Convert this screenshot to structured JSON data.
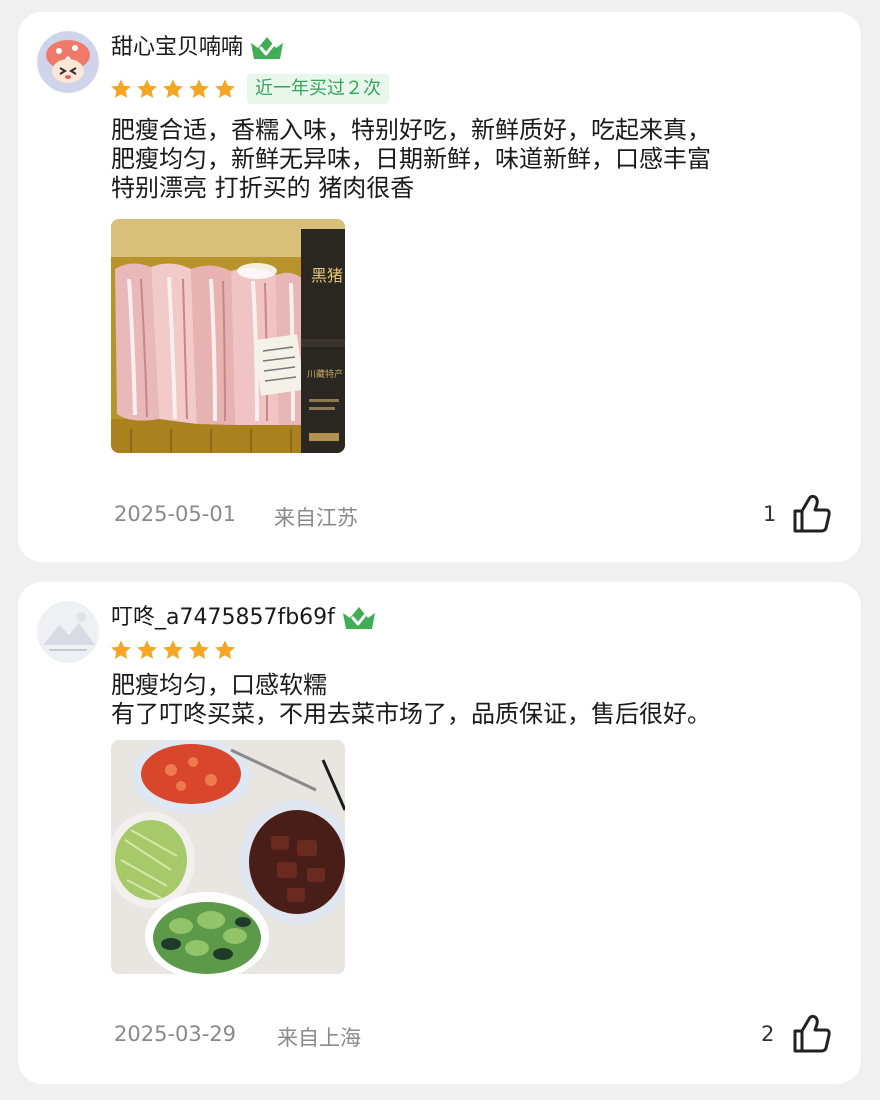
{
  "reviews": [
    {
      "username": "甜心宝贝喃喃",
      "stars": 5,
      "tag": "近一年买过２次",
      "text": "肥瘦合适，香糯入味，特别好吃，新鲜质好，吃起来真，\n肥瘦均匀，新鲜无异味，日期新鲜，味道新鲜，口感丰富\n特别漂亮 打折买的 猪肉很香",
      "photo_label": "黑猪",
      "photo_sublabel": "川藏特产",
      "date": "2025-05-01",
      "location": "来自江苏",
      "likes": "1"
    },
    {
      "username": "叮咚_a7475857fb69f",
      "stars": 5,
      "text": "肥瘦均匀，口感软糯\n有了叮咚买菜，不用去菜市场了，品质保证，售后很好。",
      "date": "2025-03-29",
      "location": "来自上海",
      "likes": "2"
    }
  ],
  "colors": {
    "star": "#f5a623",
    "badge": "#3fae56",
    "tag_text": "#35a55b",
    "tag_bg": "#e8f6ec"
  },
  "icons": [
    "verified-badge-icon",
    "star-icon",
    "thumbs-up-icon"
  ]
}
